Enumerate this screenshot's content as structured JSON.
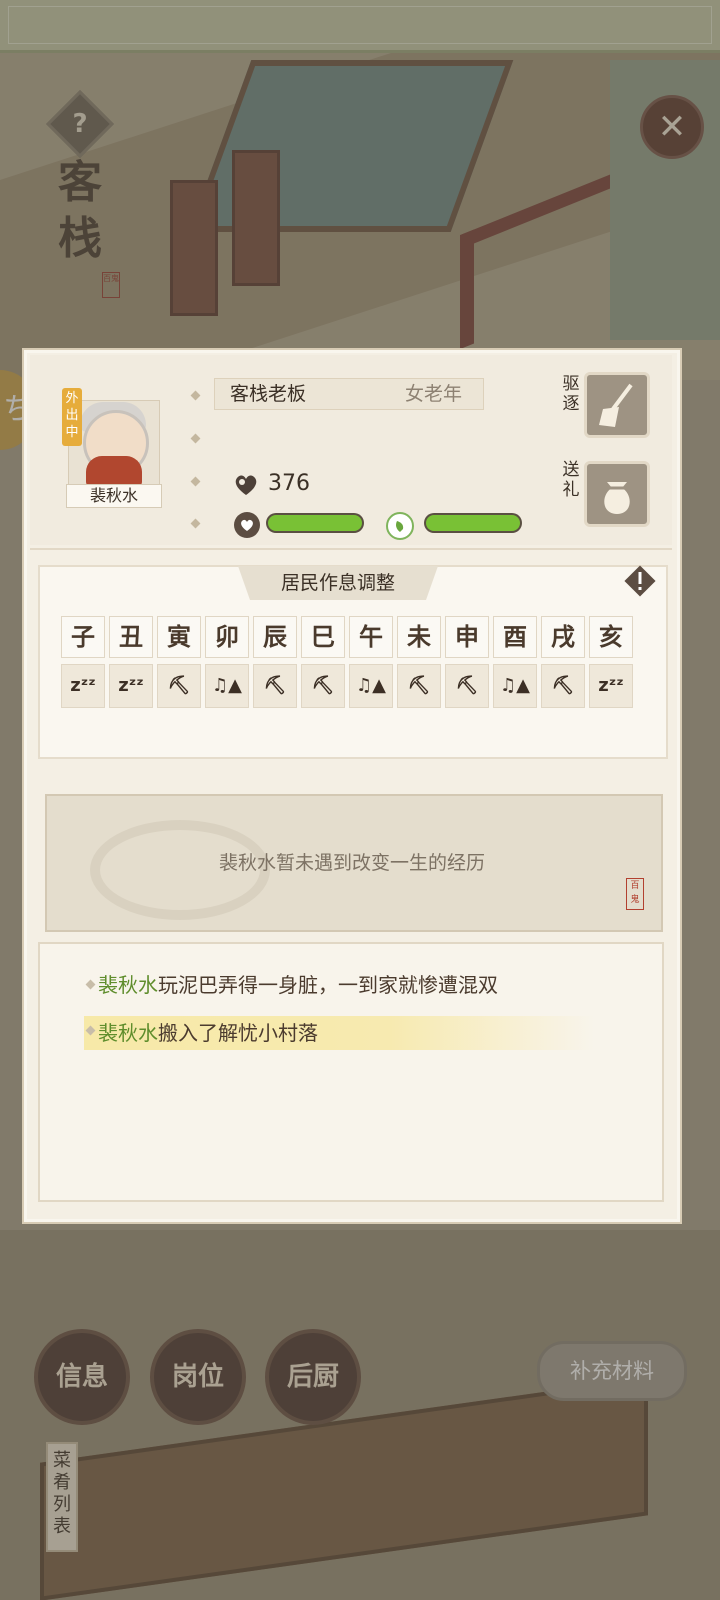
{
  "place": {
    "title": "客栈",
    "seal": "百鬼"
  },
  "controls": {
    "help_glyph": "?",
    "close_glyph": "✕",
    "side_glyph": "ち"
  },
  "character": {
    "status_tag": "外出中",
    "name": "裴秋水",
    "role": "客栈老板",
    "gender_age": "女老年",
    "money": "376",
    "bar1_level": 1.0,
    "bar2_level": 1.0
  },
  "actions": {
    "expel_label": "驱逐",
    "gift_label": "送礼"
  },
  "schedule": {
    "title": "居民作息调整",
    "hours": [
      "子",
      "丑",
      "寅",
      "卯",
      "辰",
      "巳",
      "午",
      "未",
      "申",
      "酉",
      "戌",
      "亥"
    ],
    "activities": [
      "sleep-icon",
      "sleep-icon",
      "pickaxe-icon",
      "music-person-icon",
      "pickaxe-icon",
      "pickaxe-icon",
      "music-person-icon",
      "pickaxe-icon",
      "pickaxe-icon",
      "music-person-icon",
      "pickaxe-icon",
      "sleep-icon"
    ]
  },
  "experience": {
    "text": "裴秋水暂未遇到改变一生的经历",
    "seal": "百鬼"
  },
  "log": [
    {
      "name": "裴秋水",
      "text": "玩泥巴弄得一身脏，一到家就惨遭混双",
      "highlight": false
    },
    {
      "name": "裴秋水",
      "text": "搬入了解忧小村落",
      "highlight": true
    }
  ],
  "bottom": {
    "info_label": "信息",
    "post_label": "岗位",
    "kitchen_label": "后厨",
    "supply_label": "补充材料",
    "menu_label": "菜肴列表"
  },
  "colors": {
    "accent_green": "#79c135",
    "npc_name": "#5f8d2c",
    "warn": "#5c4d42"
  }
}
